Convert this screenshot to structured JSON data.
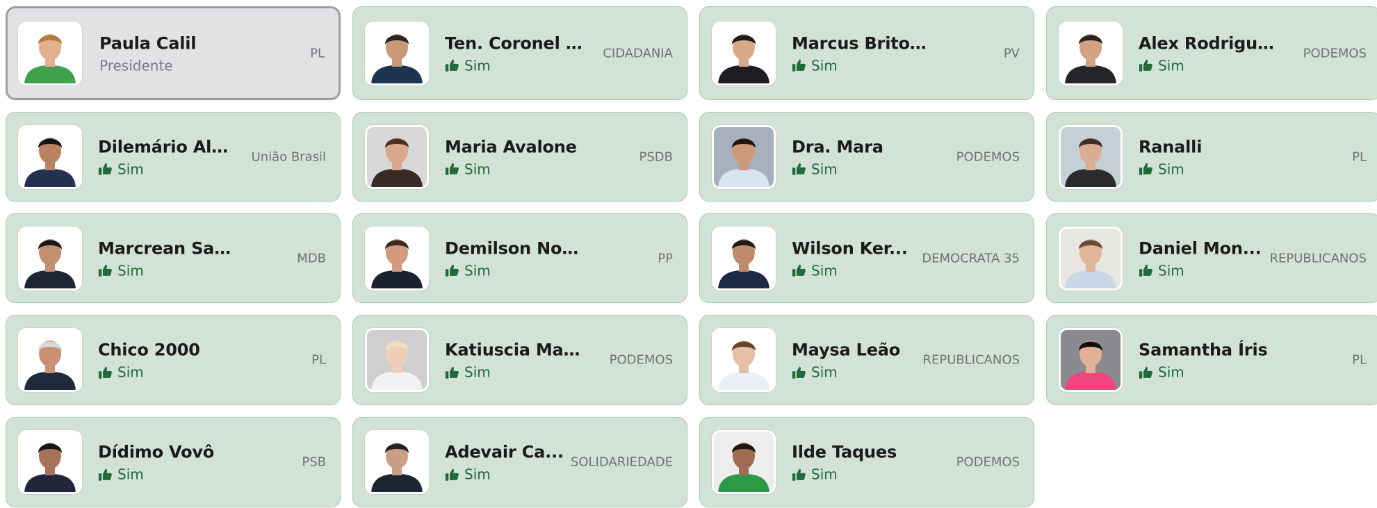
{
  "colors": {
    "card_bg": "#d2e2d6",
    "card_border": "#aec9b5",
    "president_bg": "#e1e2e4",
    "president_border": "#9b9da2",
    "vote_green": "#1f6b3a",
    "party_gray": "#6f7276"
  },
  "vote_icon": "thumbs-up-icon",
  "councillors": [
    {
      "name": "Paula Calil",
      "role": "Presidente",
      "vote": "",
      "party": "PL",
      "is_president": true,
      "skin": "#e2b08e",
      "hair": "#b27c3f",
      "shirt": "#3fa14b",
      "bg": "#ffffff"
    },
    {
      "name": "Ten. Coronel D...",
      "role": "",
      "vote": "Sim",
      "party": "CIDADANIA",
      "is_president": false,
      "skin": "#c89878",
      "hair": "#2a2420",
      "shirt": "#1e3552",
      "bg": "#ffffff"
    },
    {
      "name": "Marcus Brito Junior",
      "role": "",
      "vote": "Sim",
      "party": "PV",
      "is_president": false,
      "skin": "#d9a887",
      "hair": "#1e1a18",
      "shirt": "#1c1e24",
      "bg": "#ffffff"
    },
    {
      "name": "Alex Rodrigues",
      "role": "",
      "vote": "Sim",
      "party": "PODEMOS",
      "is_president": false,
      "skin": "#d3a183",
      "hair": "#2a2320",
      "shirt": "#242629",
      "bg": "#ffffff"
    },
    {
      "name": "Dilemário Ale...",
      "role": "",
      "vote": "Sim",
      "party": "União Brasil",
      "is_president": false,
      "skin": "#b98363",
      "hair": "#181514",
      "shirt": "#22314f",
      "bg": "#ffffff"
    },
    {
      "name": "Maria Avalone",
      "role": "",
      "vote": "Sim",
      "party": "PSDB",
      "is_president": false,
      "skin": "#d7a88b",
      "hair": "#4d3023",
      "shirt": "#3a2a24",
      "bg": "#d8d8d8"
    },
    {
      "name": "Dra. Mara",
      "role": "",
      "vote": "Sim",
      "party": "PODEMOS",
      "is_president": false,
      "skin": "#cf9878",
      "hair": "#1d1816",
      "shirt": "#d8e4f2",
      "bg": "#a8b0bb"
    },
    {
      "name": "Ranalli",
      "role": "",
      "vote": "Sim",
      "party": "PL",
      "is_president": false,
      "skin": "#d8ad93",
      "hair": "#3b2f28",
      "shirt": "#2b2b2e",
      "bg": "#c5cfd6"
    },
    {
      "name": "Marcrean Santos",
      "role": "",
      "vote": "Sim",
      "party": "MDB",
      "is_president": false,
      "skin": "#c28f71",
      "hair": "#1b1714",
      "shirt": "#1e2636",
      "bg": "#ffffff"
    },
    {
      "name": "Demilson Nogueira",
      "role": "",
      "vote": "Sim",
      "party": "PP",
      "is_president": false,
      "skin": "#d39a7e",
      "hair": "#3a2c25",
      "shirt": "#1d2230",
      "bg": "#ffffff"
    },
    {
      "name": "Wilson Ker...",
      "role": "",
      "vote": "Sim",
      "party": "DEMOCRATA 35",
      "is_president": false,
      "skin": "#be8a6c",
      "hair": "#201b18",
      "shirt": "#1d2a44",
      "bg": "#ffffff"
    },
    {
      "name": "Daniel Mon...",
      "role": "",
      "vote": "Sim",
      "party": "REPUBLICANOS",
      "is_president": false,
      "skin": "#e0b497",
      "hair": "#6b4a34",
      "shirt": "#c9d8e6",
      "bg": "#e8e6e2"
    },
    {
      "name": "Chico 2000",
      "role": "",
      "vote": "Sim",
      "party": "PL",
      "is_president": false,
      "skin": "#c99073",
      "hair": "#d8d8d8",
      "shirt": "#1f2a3e",
      "bg": "#ffffff"
    },
    {
      "name": "Katiuscia Manteli",
      "role": "",
      "vote": "Sim",
      "party": "PODEMOS",
      "is_president": false,
      "skin": "#efcfb8",
      "hair": "#efe0c0",
      "shirt": "#f2f2f2",
      "bg": "#cfcfd1"
    },
    {
      "name": "Maysa Leão",
      "role": "",
      "vote": "Sim",
      "party": "REPUBLICANOS",
      "is_president": false,
      "skin": "#e5bfa6",
      "hair": "#6a4029",
      "shirt": "#eaf0f6",
      "bg": "#ffffff"
    },
    {
      "name": "Samantha Íris",
      "role": "",
      "vote": "Sim",
      "party": "PL",
      "is_president": false,
      "skin": "#e0b197",
      "hair": "#141113",
      "shirt": "#f0457f",
      "bg": "#8a8a8f"
    },
    {
      "name": "Dídimo Vovô",
      "role": "",
      "vote": "Sim",
      "party": "PSB",
      "is_president": false,
      "skin": "#a8725a",
      "hair": "#191514",
      "shirt": "#23253a",
      "bg": "#ffffff"
    },
    {
      "name": "Adevair Ca...",
      "role": "",
      "vote": "Sim",
      "party": "SOLIDARIEDADE",
      "is_president": false,
      "skin": "#caa085",
      "hair": "#2a2220",
      "shirt": "#1d2434",
      "bg": "#ffffff"
    },
    {
      "name": "Ilde Taques",
      "role": "",
      "vote": "Sim",
      "party": "PODEMOS",
      "is_president": false,
      "skin": "#9f6c53",
      "hair": "#1a1614",
      "shirt": "#2d9a48",
      "bg": "#ededed"
    }
  ]
}
